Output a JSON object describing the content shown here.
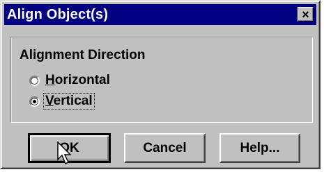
{
  "window": {
    "title": "Align Object(s)",
    "close_label": "×"
  },
  "group": {
    "title": "Alignment Direction",
    "options": [
      {
        "mnemonic": "H",
        "rest": "orizontal",
        "checked": false
      },
      {
        "mnemonic": "V",
        "rest": "ertical",
        "checked": true
      }
    ]
  },
  "buttons": {
    "ok": "OK",
    "cancel": "Cancel",
    "help": "Help..."
  },
  "colors": {
    "face": "#c0c0c0",
    "titlebar": "#000080"
  },
  "cursor_icon": "arrow-pointer-icon"
}
